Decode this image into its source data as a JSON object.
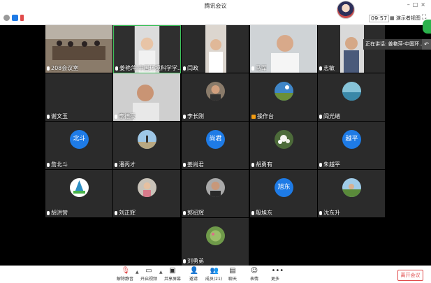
{
  "window": {
    "title": "腾讯会议",
    "controls": [
      "minimize-icon",
      "maximize-icon",
      "close-icon"
    ]
  },
  "topbar": {
    "time": "09:57",
    "gallery_view_label": "演示者视图"
  },
  "speaking": {
    "label": "正在讲话: 姜艳萍-中国环..."
  },
  "participants": [
    {
      "name": "208会议室",
      "type": "video"
    },
    {
      "name": "姜艳萍-中国环境科学学...",
      "type": "video"
    },
    {
      "name": "闫政",
      "type": "video"
    },
    {
      "name": "马军",
      "type": "video"
    },
    {
      "name": "志敏",
      "type": "video"
    },
    {
      "name": "谢文玉",
      "type": "blank"
    },
    {
      "name": "李德豪",
      "type": "video"
    },
    {
      "name": "李长刚",
      "type": "avatar"
    },
    {
      "name": "操作台",
      "type": "avatar"
    },
    {
      "name": "阎光绪",
      "type": "avatar"
    },
    {
      "name": "詹北斗",
      "type": "text",
      "avatar_text": "北斗"
    },
    {
      "name": "潘丙才",
      "type": "avatar"
    },
    {
      "name": "姜尚君",
      "type": "text",
      "avatar_text": "尚君"
    },
    {
      "name": "胡勇有",
      "type": "avatar"
    },
    {
      "name": "朱越平",
      "type": "text",
      "avatar_text": "越平"
    },
    {
      "name": "胡洪营",
      "type": "avatar"
    },
    {
      "name": "刘正辉",
      "type": "avatar"
    },
    {
      "name": "郭绍辉",
      "type": "avatar"
    },
    {
      "name": "殷旭东",
      "type": "text",
      "avatar_text": "旭东"
    },
    {
      "name": "沈东升",
      "type": "avatar"
    },
    {
      "name": "刘勇弟",
      "type": "avatar"
    }
  ],
  "toolbar": {
    "unmute": "解除静音",
    "start_video": "开启视频",
    "share_screen": "共享屏幕",
    "invite": "邀请",
    "members": "成员(21)",
    "chat": "聊天",
    "emoji": "表情",
    "more": "更多",
    "leave": "离开会议"
  },
  "colors": {
    "avatar_text_bg": "#1e7be6",
    "leave_red": "#e04a4a",
    "tile_bg": "#2b2b2b"
  }
}
